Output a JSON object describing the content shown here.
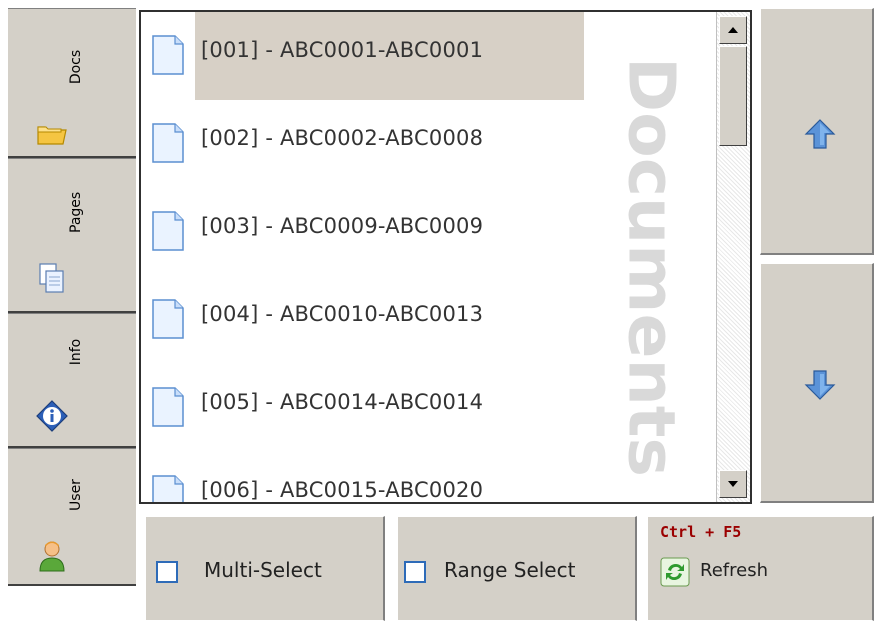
{
  "tabs": [
    {
      "label": "Docs",
      "icon": "folder-icon"
    },
    {
      "label": "Pages",
      "icon": "pages-icon"
    },
    {
      "label": "Info",
      "icon": "info-icon"
    },
    {
      "label": "User",
      "icon": "user-icon"
    }
  ],
  "documents": {
    "watermark": "Documents",
    "items": [
      {
        "label": "[001] - ABC0001-ABC0001",
        "selected": true
      },
      {
        "label": "[002] - ABC0002-ABC0008",
        "selected": false
      },
      {
        "label": "[003] - ABC0009-ABC0009",
        "selected": false
      },
      {
        "label": "[004] - ABC0010-ABC0013",
        "selected": false
      },
      {
        "label": "[005] - ABC0014-ABC0014",
        "selected": false
      },
      {
        "label": "[006] - ABC0015-ABC0020",
        "selected": false
      }
    ]
  },
  "navigation": {
    "up_icon": "arrow-up-icon",
    "down_icon": "arrow-down-icon"
  },
  "actions": {
    "multi_select": "Multi-Select",
    "range_select": "Range Select",
    "refresh_shortcut": "Ctrl + F5",
    "refresh": "Refresh"
  },
  "colors": {
    "selection": "#d7d0c6",
    "panel": "#d4d0c8",
    "shortcut_text": "#9b0000",
    "checkbox_border": "#2e6bb8",
    "arrow_blue": "#5b93d8"
  }
}
